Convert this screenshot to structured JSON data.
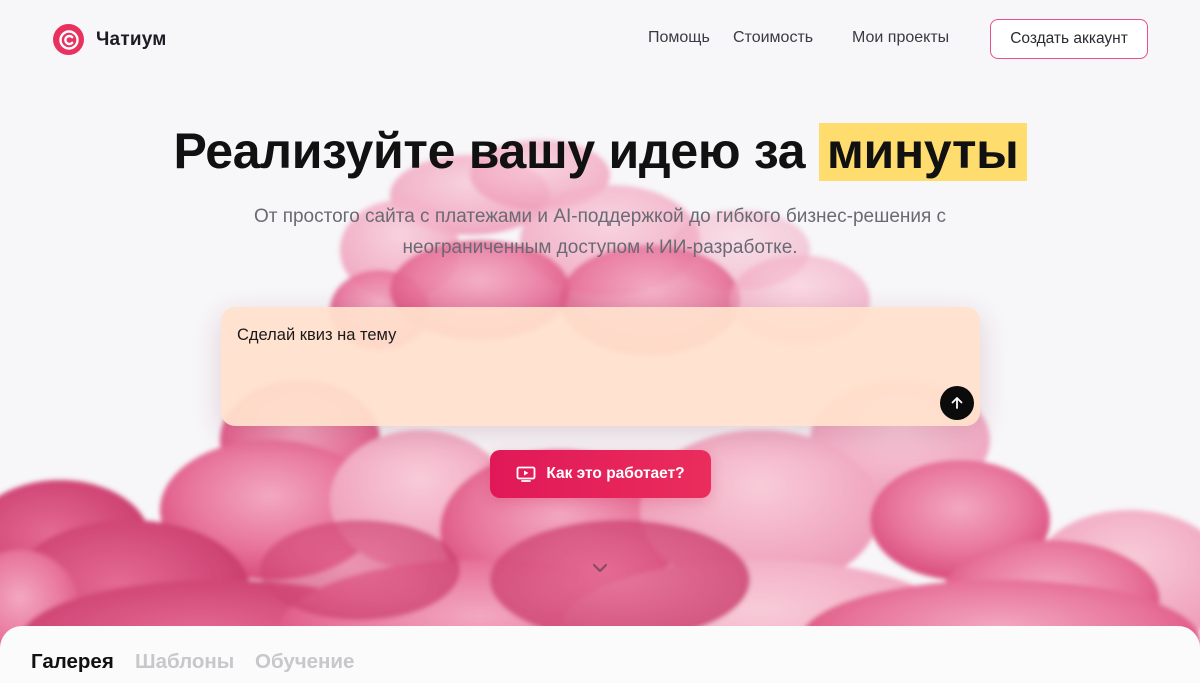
{
  "brand": {
    "name": "Чатиум",
    "accent": "#e8315f",
    "icon": "logo-chat-icon"
  },
  "nav": {
    "help": "Помощь",
    "pricing": "Стоимость",
    "projects": "Мои проекты",
    "signup": "Создать аккаунт"
  },
  "hero": {
    "title_main": "Реализуйте вашу идею за",
    "title_highlight": "минуты",
    "highlight_color": "#ffdc6e",
    "subtitle": "От простого сайта с платежами и AI-поддержкой до гибкого бизнес-решения с неограниченным доступом к ИИ-разработке."
  },
  "prompt": {
    "value": "Сделай квиз на тему",
    "send_icon": "arrow-up-icon"
  },
  "cta": {
    "how_it_works": "Как это работает?",
    "icon": "play-screen-icon",
    "color": "#e01858"
  },
  "scroll_icon": "chevron-down-icon",
  "tabs": [
    {
      "label": "Галерея",
      "active": true
    },
    {
      "label": "Шаблоны",
      "active": false
    },
    {
      "label": "Обучение",
      "active": false
    }
  ]
}
